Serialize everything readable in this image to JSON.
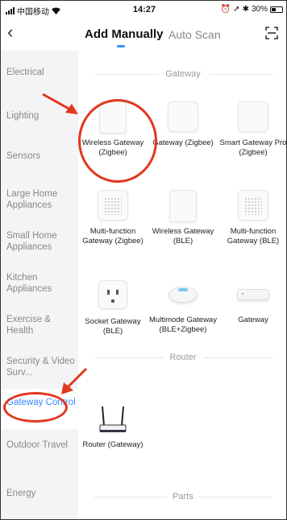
{
  "status_bar": {
    "carrier": "中国移动",
    "time": "14:27",
    "battery": "30%"
  },
  "nav": {
    "active_tab": "Add Manually",
    "other_tab": "Auto Scan"
  },
  "sidebar": {
    "items": [
      {
        "label": "Electrical"
      },
      {
        "label": "Lighting"
      },
      {
        "label": "Sensors"
      },
      {
        "label": "Large Home Appliances"
      },
      {
        "label": "Small Home Appliances"
      },
      {
        "label": "Kitchen Appliances"
      },
      {
        "label": "Exercise & Health"
      },
      {
        "label": "Security & Video Surv..."
      },
      {
        "label": "Gateway Control"
      },
      {
        "label": "Outdoor Travel"
      },
      {
        "label": "Energy"
      }
    ]
  },
  "sections": {
    "gateway": "Gateway",
    "router": "Router",
    "parts": "Parts"
  },
  "devices": {
    "wireless_zigbee": "Wireless Gateway (Zigbee)",
    "gateway_zigbee": "Gateway (Zigbee)",
    "smart_gateway_pro": "Smart Gateway Pro (Zigbee)",
    "multi_zigbee": "Multi-function Gateway (Zigbee)",
    "wireless_ble": "Wireless Gateway (BLE)",
    "multi_ble": "Multi-function Gateway (BLE)",
    "socket_ble": "Socket Gateway (BLE)",
    "multimode": "Multimode Gateway (BLE+Zigbee)",
    "gateway": "Gateway",
    "router": "Router (Gateway)"
  },
  "colors": {
    "accent": "#3c87ff",
    "annotation": "#e2361e",
    "sidebar_bg": "#f4f4f6"
  }
}
